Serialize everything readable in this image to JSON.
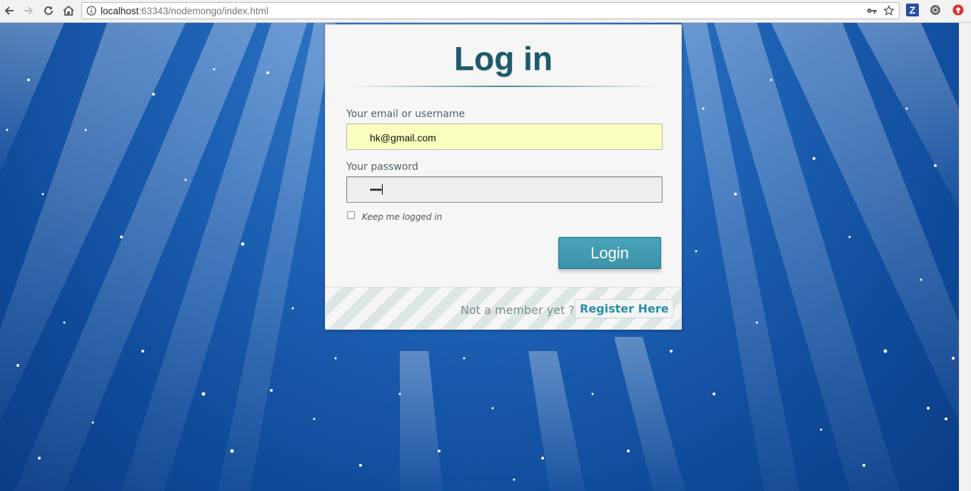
{
  "browser": {
    "url_host": "localhost",
    "url_path": ":63343/nodemongo/index.html",
    "icons": [
      "back-icon",
      "forward-icon",
      "reload-icon",
      "home-icon",
      "info-icon",
      "key-icon",
      "star-icon",
      "zotero-icon",
      "extension-icon",
      "extension-red-icon"
    ],
    "extension_letter": "Z"
  },
  "login": {
    "title": "Log in",
    "email_label": "Your email or username",
    "email_value": "hk@gmail.com",
    "password_label": "Your password",
    "password_value": "•••••",
    "keep_logged_in_label": "Keep me logged in",
    "keep_logged_in_checked": false,
    "submit_label": "Login",
    "footer_text": "Not a member yet ?",
    "register_label": "Register Here"
  },
  "colors": {
    "accent": "#3a93a8",
    "title": "#1c5a6c",
    "autofill": "#faffbd",
    "background": "#1f63b6"
  }
}
